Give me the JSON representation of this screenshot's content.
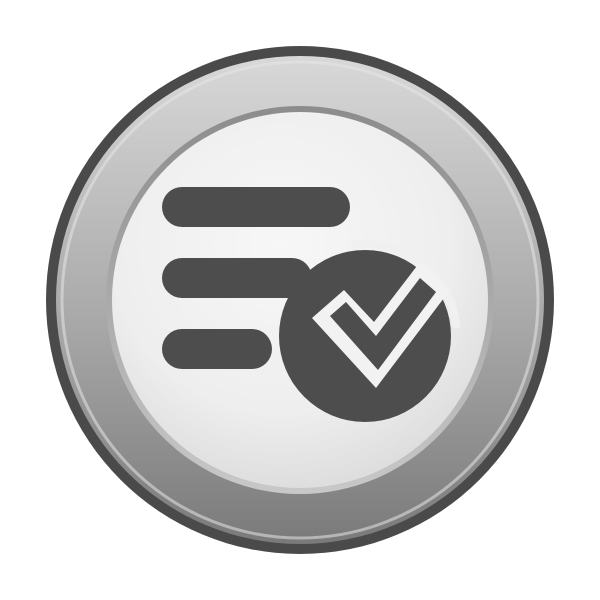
{
  "icon": {
    "name": "task-list-check-icon",
    "colors": {
      "outer_ring": "#4a4a4a",
      "bezel_light": "#d8d8d8",
      "bezel_mid": "#a8a8a8",
      "bezel_dark": "#7a7a7a",
      "face_light": "#f7f7f7",
      "face_shadow": "#d6d6d6",
      "glyph": "#4d4d4d"
    },
    "list_lines": 3,
    "has_check_badge": true
  }
}
